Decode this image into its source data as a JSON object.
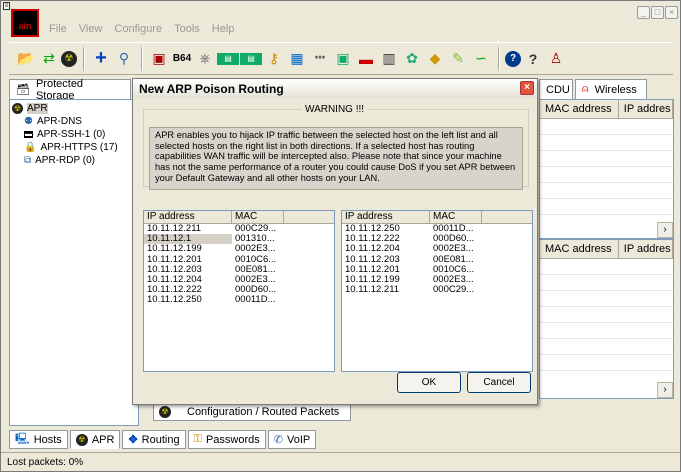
{
  "window": {
    "menu": [
      "File",
      "View",
      "Configure",
      "Tools",
      "Help"
    ],
    "controls": [
      "minimize-icon",
      "maximize-icon",
      "close-icon"
    ]
  },
  "toolbar": {
    "buttons": [
      "open-icon",
      "save-icon",
      "apr-icon",
      "add-icon",
      "sniffer-icon",
      "crack-icon",
      "base64-icon",
      "scan-icon",
      "wep-icon",
      "lsa-icon",
      "routes-icon",
      "packet-icon",
      "password-icon",
      "network-icon",
      "terminal-icon",
      "hash-icon",
      "cdu-icon",
      "certificate-icon",
      "voip-icon",
      "wireless-icon",
      "help-icon",
      "about-icon",
      "info-icon"
    ],
    "b64_label": "B64"
  },
  "tabs_top": {
    "protected_storage": "Protected Storage",
    "cdu": "CDU",
    "wireless": "Wireless"
  },
  "tree": {
    "items": [
      "APR",
      "APR-DNS",
      "APR-SSH-1 (0)",
      "APR-HTTPS (17)",
      "APR-RDP (0)"
    ]
  },
  "right_pane": {
    "col_mac": "MAC address",
    "col_ip": "IP addres"
  },
  "dialog": {
    "title": "New ARP Poison Routing",
    "legend": "WARNING !!!",
    "warning": "APR enables you to hijack IP traffic between the selected host on the left list and all selected hosts on the right list in both directions. If a selected host has routing capabilities WAN traffic will be intercepted also. Please note that since your machine has not the same performance of a router you could cause DoS if you set APR between your Default Gateway and all other hosts on your LAN.",
    "col_ip": "IP address",
    "col_mac": "MAC",
    "left_rows": [
      [
        "10.11.12.211",
        "000C29..."
      ],
      [
        "10.11.12.1",
        "001310..."
      ],
      [
        "10.11.12.199",
        "0002E3..."
      ],
      [
        "10.11.12.201",
        "0010C6..."
      ],
      [
        "10.11.12.203",
        "00E081..."
      ],
      [
        "10.11.12.204",
        "0002E3..."
      ],
      [
        "10.11.12.222",
        "000D60..."
      ],
      [
        "10.11.12.250",
        "00011D..."
      ]
    ],
    "right_rows": [
      [
        "10.11.12.250",
        "00011D..."
      ],
      [
        "10.11.12.222",
        "000D60..."
      ],
      [
        "10.11.12.204",
        "0002E3..."
      ],
      [
        "10.11.12.203",
        "00E081..."
      ],
      [
        "10.11.12.201",
        "0010C6..."
      ],
      [
        "10.11.12.199",
        "0002E3..."
      ],
      [
        "10.11.12.211",
        "000C29..."
      ]
    ],
    "ok": "OK",
    "cancel": "Cancel"
  },
  "inner_tab": "Configuration / Routed Packets",
  "bottom_tabs": [
    "Hosts",
    "APR",
    "Routing",
    "Passwords",
    "VoIP"
  ],
  "status": "Lost packets:  0%"
}
